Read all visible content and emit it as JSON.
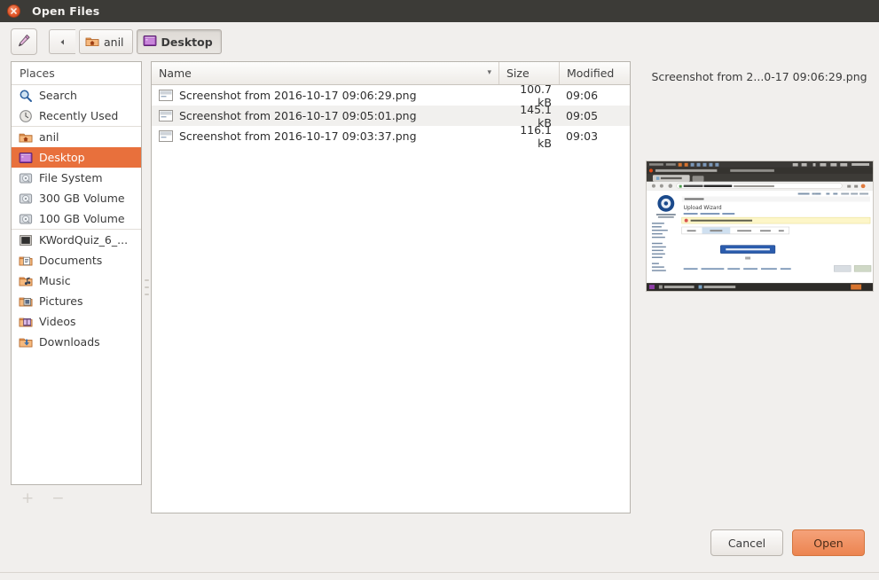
{
  "window": {
    "title": "Open Files",
    "close_icon": "close-icon"
  },
  "toolbar": {
    "type_path_icon": "pencil-icon",
    "back_icon": "chevron-left-icon",
    "breadcrumbs": [
      {
        "label": "anil",
        "icon": "home-folder-icon",
        "active": false
      },
      {
        "label": "Desktop",
        "icon": "desktop-icon",
        "active": true
      }
    ]
  },
  "places": {
    "header": "Places",
    "items": [
      {
        "label": "Search",
        "icon": "search-icon"
      },
      {
        "label": "Recently Used",
        "icon": "clock-icon"
      },
      {
        "label": "anil",
        "icon": "home-folder-icon"
      },
      {
        "label": "Desktop",
        "icon": "desktop-icon"
      },
      {
        "label": "File System",
        "icon": "harddisk-icon"
      },
      {
        "label": "300 GB Volume",
        "icon": "harddisk-icon"
      },
      {
        "label": "100 GB Volume",
        "icon": "harddisk-icon"
      },
      {
        "label": "KWordQuiz_6_...",
        "icon": "disc-icon"
      },
      {
        "label": "Documents",
        "icon": "documents-folder-icon"
      },
      {
        "label": "Music",
        "icon": "music-folder-icon"
      },
      {
        "label": "Pictures",
        "icon": "pictures-folder-icon"
      },
      {
        "label": "Videos",
        "icon": "videos-folder-icon"
      },
      {
        "label": "Downloads",
        "icon": "downloads-folder-icon"
      }
    ],
    "selected": "Desktop",
    "add_label": "+",
    "remove_label": "−"
  },
  "file_list": {
    "columns": [
      {
        "key": "name",
        "label": "Name",
        "sorted": true,
        "sort_arrow": "▾"
      },
      {
        "key": "size",
        "label": "Size"
      },
      {
        "key": "modified",
        "label": "Modified"
      }
    ],
    "rows": [
      {
        "name": "Screenshot from 2016-10-17 09:06:29.png",
        "size": "100.7 kB",
        "modified": "09:06",
        "icon": "image-file-icon"
      },
      {
        "name": "Screenshot from 2016-10-17 09:05:01.png",
        "size": "145.1 kB",
        "modified": "09:05",
        "icon": "image-file-icon"
      },
      {
        "name": "Screenshot from 2016-10-17 09:03:37.png",
        "size": "116.1 kB",
        "modified": "09:03",
        "icon": "image-file-icon"
      }
    ]
  },
  "preview": {
    "filename": "Screenshot from 2...0-17 09:06:29.png",
    "thumbnail_alt": "upload-wizard-browser-screenshot"
  },
  "footer": {
    "cancel_label": "Cancel",
    "open_label": "Open"
  },
  "colors": {
    "titlebar": "#3c3b37",
    "selection": "#e8703c",
    "primary_button": "#ec8450",
    "window_bg": "#f1efed"
  }
}
